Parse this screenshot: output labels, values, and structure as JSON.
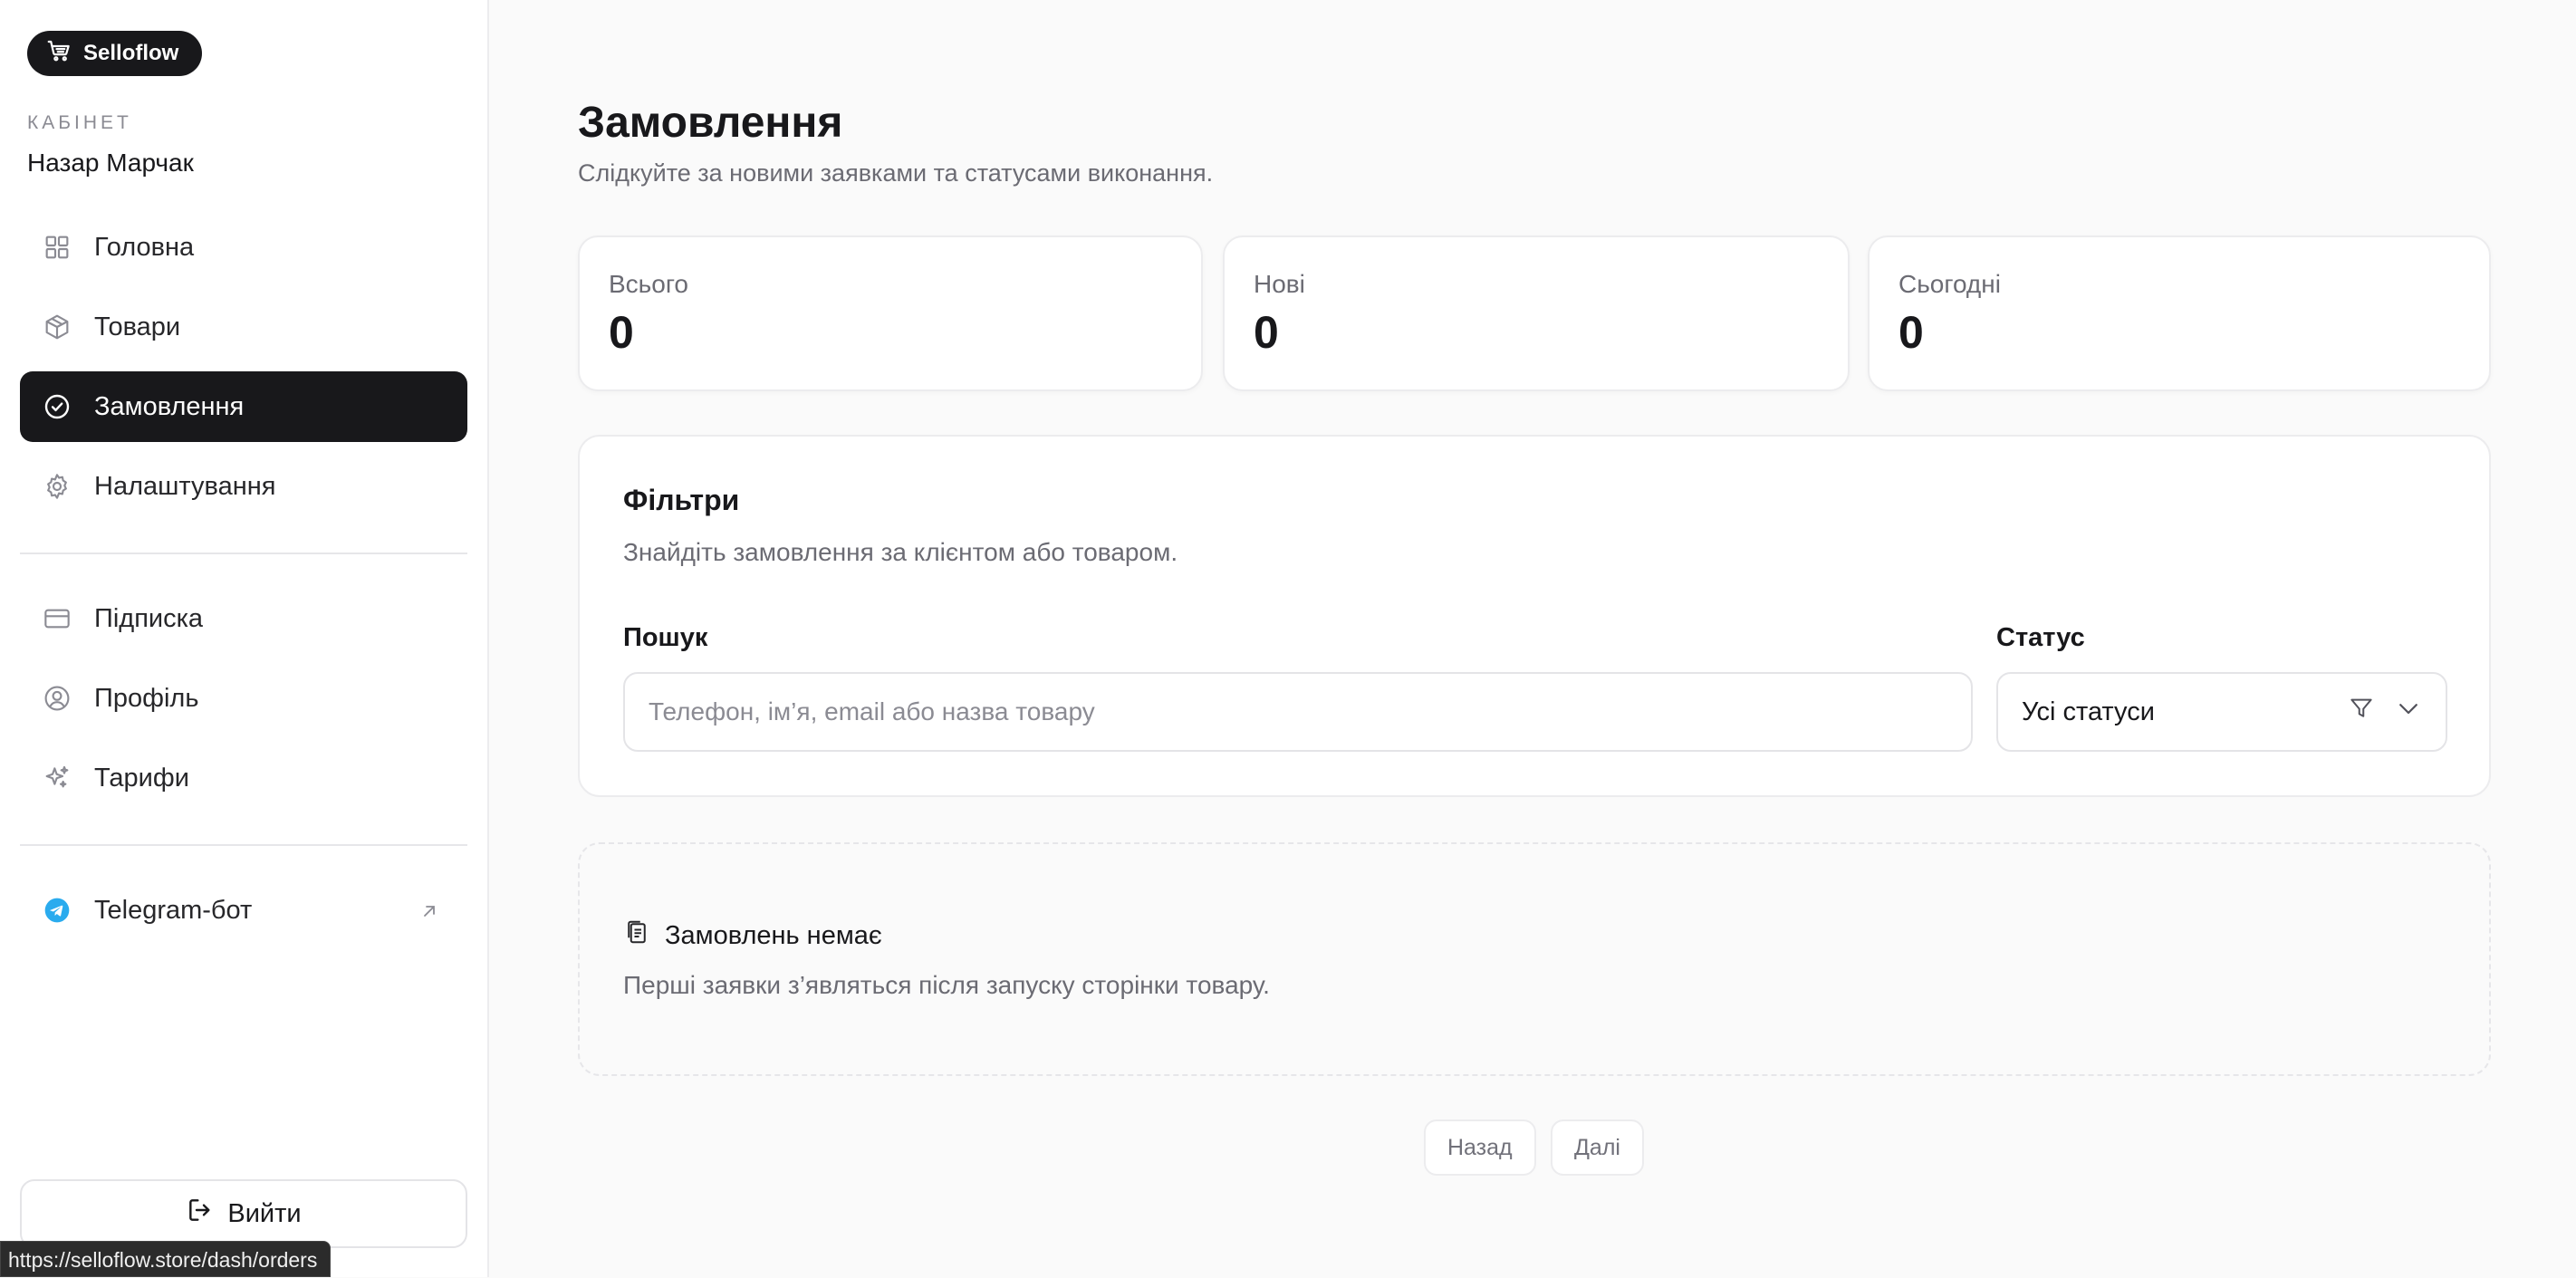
{
  "brand": {
    "name": "Selloflow",
    "icon": "cart-icon"
  },
  "account": {
    "section_label": "КАБІНЕТ",
    "user_name": "Назар Марчак"
  },
  "nav": {
    "items": [
      {
        "label": "Головна",
        "icon": "grid-icon"
      },
      {
        "label": "Товари",
        "icon": "box-icon"
      },
      {
        "label": "Замовлення",
        "icon": "check-circle-icon",
        "active": true
      },
      {
        "label": "Налаштування",
        "icon": "gear-icon"
      }
    ],
    "secondary": [
      {
        "label": "Підписка",
        "icon": "credit-card-icon"
      },
      {
        "label": "Профіль",
        "icon": "user-circle-icon"
      },
      {
        "label": "Тарифи",
        "icon": "sparkles-icon"
      }
    ],
    "telegram": {
      "label": "Telegram-бот",
      "icon": "telegram-icon",
      "external_icon": "arrow-up-right-icon"
    }
  },
  "logout": {
    "label": "Вийти",
    "icon": "logout-icon"
  },
  "status_url": "https://selloflow.store/dash/orders",
  "page": {
    "title": "Замовлення",
    "subtitle": "Слідкуйте за новими заявками та статусами виконання."
  },
  "stats": [
    {
      "label": "Всього",
      "value": "0"
    },
    {
      "label": "Нові",
      "value": "0"
    },
    {
      "label": "Сьогодні",
      "value": "0"
    }
  ],
  "filters": {
    "title": "Фільтри",
    "subtitle": "Знайдіть замовлення за клієнтом або товаром.",
    "search_label": "Пошук",
    "search_placeholder": "Телефон, ім’я, email або назва товару",
    "search_value": "",
    "status_label": "Статус",
    "status_value": "Усі статуси"
  },
  "empty_state": {
    "title": "Замовлень немає",
    "subtitle": "Перші заявки з’являться після запуску сторінки товару.",
    "icon": "clipboard-icon"
  },
  "pagination": {
    "prev_label": "Назад",
    "next_label": "Далі"
  },
  "colors": {
    "accent": "#18181b",
    "background": "#fafafa",
    "telegram": "#2AABEE"
  }
}
